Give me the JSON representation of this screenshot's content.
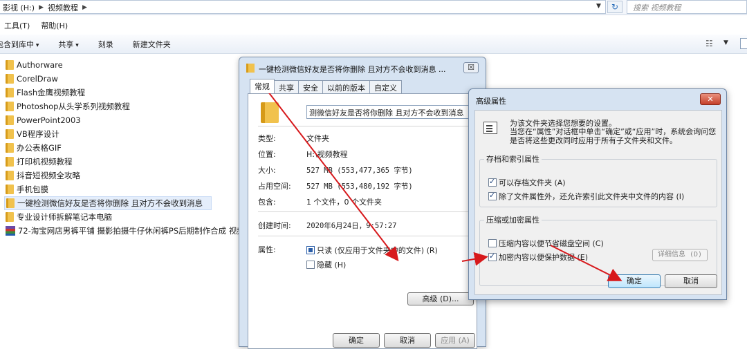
{
  "explorer": {
    "breadcrumbs": [
      "影视 (H:)",
      "视频教程"
    ],
    "search_placeholder": "搜索 视频教程",
    "menu": [
      "工具(T)",
      "帮助(H)"
    ],
    "toolbar": [
      "包含到库中",
      "共享",
      "刻录",
      "新建文件夹"
    ],
    "files": [
      {
        "name": "Authorware",
        "type": "folder"
      },
      {
        "name": "CorelDraw",
        "type": "folder"
      },
      {
        "name": "Flash金鹰视频教程",
        "type": "folder"
      },
      {
        "name": "Photoshop从头学系列视频教程",
        "type": "folder"
      },
      {
        "name": "PowerPoint2003",
        "type": "folder"
      },
      {
        "name": "VB程序设计",
        "type": "folder"
      },
      {
        "name": "办公表格GIF",
        "type": "folder"
      },
      {
        "name": "打印机视频教程",
        "type": "folder"
      },
      {
        "name": "抖音短视频全攻略",
        "type": "folder"
      },
      {
        "name": "手机包膜",
        "type": "folder"
      },
      {
        "name": "一键检测微信好友是否将你删除 且对方不会收到消息",
        "type": "folder",
        "selected": true
      },
      {
        "name": "专业设计师拆解笔记本电脑",
        "type": "folder"
      },
      {
        "name": "72-淘宝网店男裤平铺 摄影拍摄牛仔休闲裤PS后期制作合成 视频",
        "type": "archive"
      }
    ]
  },
  "properties_dialog": {
    "title": "一键检测微信好友是否将你删除 且对方不会收到消息 ...",
    "close_label": "☒",
    "tabs": [
      "常规",
      "共享",
      "安全",
      "以前的版本",
      "自定义"
    ],
    "active_tab": 0,
    "name_value": "测微信好友是否将你删除 且对方不会收到消息",
    "type_label": "类型:",
    "type_value": "文件夹",
    "location_label": "位置:",
    "location_value": "H:\\视频教程",
    "size_label": "大小:",
    "size_value": "527 MB (553,477,365 字节)",
    "disk_size_label": "占用空间:",
    "disk_size_value": "527 MB (553,480,192 字节)",
    "contains_label": "包含:",
    "contains_value": "1 个文件，0 个文件夹",
    "created_label": "创建时间:",
    "created_value": "2020年6月24日，9:57:27",
    "attributes_label": "属性:",
    "readonly_label": "只读 (仅应用于文件夹中的文件) (R)",
    "hidden_label": "隐藏 (H)",
    "advanced_button": "高级 (D)...",
    "ok_button": "确定",
    "cancel_button": "取消",
    "apply_button": "应用 (A)"
  },
  "advanced_dialog": {
    "title": "高级属性",
    "close_label": "✕",
    "desc1": "为该文件夹选择您想要的设置。",
    "desc2": "当您在“属性”对话框中单击“确定”或“应用”时，系统会询问您是否将这些更改同时应用于所有子文件夹和文件。",
    "archive_group": "存档和索引属性",
    "archive_label": "可以存档文件夹 (A)",
    "index_label": "除了文件属性外，还允许索引此文件夹中文件的内容 (I)",
    "compress_group": "压缩或加密属性",
    "compress_label": "压缩内容以便节省磁盘空间 (C)",
    "encrypt_label": "加密内容以便保护数据 (E)",
    "details_button": "详细信息 (D)",
    "ok_button": "确定",
    "cancel_button": "取消",
    "states": {
      "archive": true,
      "index": true,
      "compress": false,
      "encrypt": true
    }
  },
  "colors": {
    "arrow": "#d7191c",
    "title_bar": "#d6e3f2",
    "selection": "#e5eefb"
  }
}
